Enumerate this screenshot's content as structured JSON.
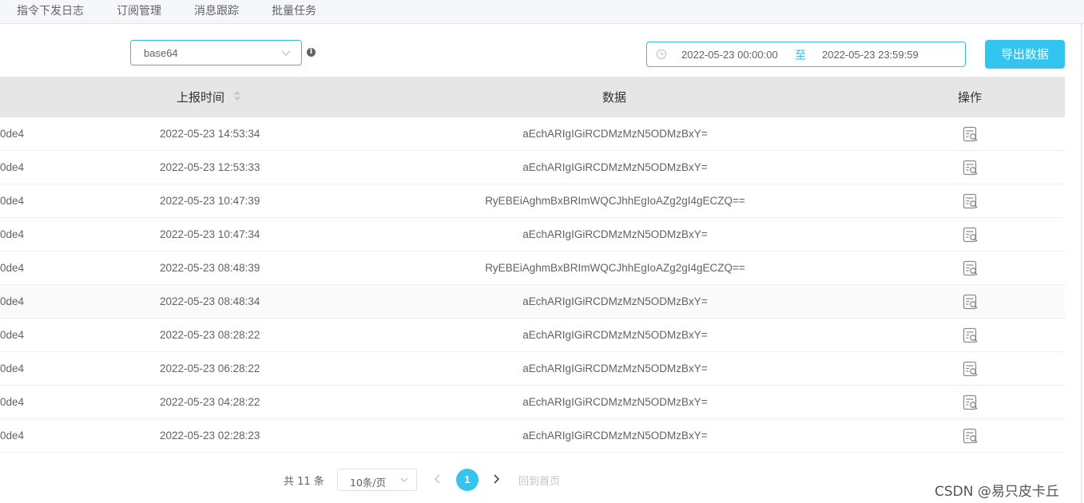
{
  "tabs": [
    "指令下发日志",
    "订阅管理",
    "消息跟踪",
    "批量任务"
  ],
  "toolbar": {
    "encoding_value": "base64",
    "date_start": "2022-05-23 00:00:00",
    "date_separator": "至",
    "date_end": "2022-05-23 23:59:59",
    "export_label": "导出数据"
  },
  "table": {
    "headers": {
      "time": "上报时间",
      "data": "数据",
      "action": "操作"
    },
    "rows": [
      {
        "id": "0de4",
        "time": "2022-05-23 14:53:34",
        "data": "aEchARIgIGiRCDMzMzN5ODMzBxY="
      },
      {
        "id": "0de4",
        "time": "2022-05-23 12:53:33",
        "data": "aEchARIgIGiRCDMzMzN5ODMzBxY="
      },
      {
        "id": "0de4",
        "time": "2022-05-23 10:47:39",
        "data": "RyEBEiAghmBxBRImWQCJhhEgIoAZg2gI4gECZQ=="
      },
      {
        "id": "0de4",
        "time": "2022-05-23 10:47:34",
        "data": "aEchARIgIGiRCDMzMzN5ODMzBxY="
      },
      {
        "id": "0de4",
        "time": "2022-05-23 08:48:39",
        "data": "RyEBEiAghmBxBRImWQCJhhEgIoAZg2gI4gECZQ=="
      },
      {
        "id": "0de4",
        "time": "2022-05-23 08:48:34",
        "data": "aEchARIgIGiRCDMzMzN5ODMzBxY="
      },
      {
        "id": "0de4",
        "time": "2022-05-23 08:28:22",
        "data": "aEchARIgIGiRCDMzMzN5ODMzBxY="
      },
      {
        "id": "0de4",
        "time": "2022-05-23 06:28:22",
        "data": "aEchARIgIGiRCDMzMzN5ODMzBxY="
      },
      {
        "id": "0de4",
        "time": "2022-05-23 04:28:22",
        "data": "aEchARIgIGiRCDMzMzN5ODMzBxY="
      },
      {
        "id": "0de4",
        "time": "2022-05-23 02:28:23",
        "data": "aEchARIgIGiRCDMzMzN5ODMzBxY="
      }
    ]
  },
  "pagination": {
    "total_text": "共 11 条",
    "page_size": "10条/页",
    "current_page": "1",
    "home_label": "回到首页"
  },
  "watermark": "CSDN @易只皮卡丘",
  "colors": {
    "accent": "#33c4f0",
    "header_bg": "#e6e6e6"
  }
}
